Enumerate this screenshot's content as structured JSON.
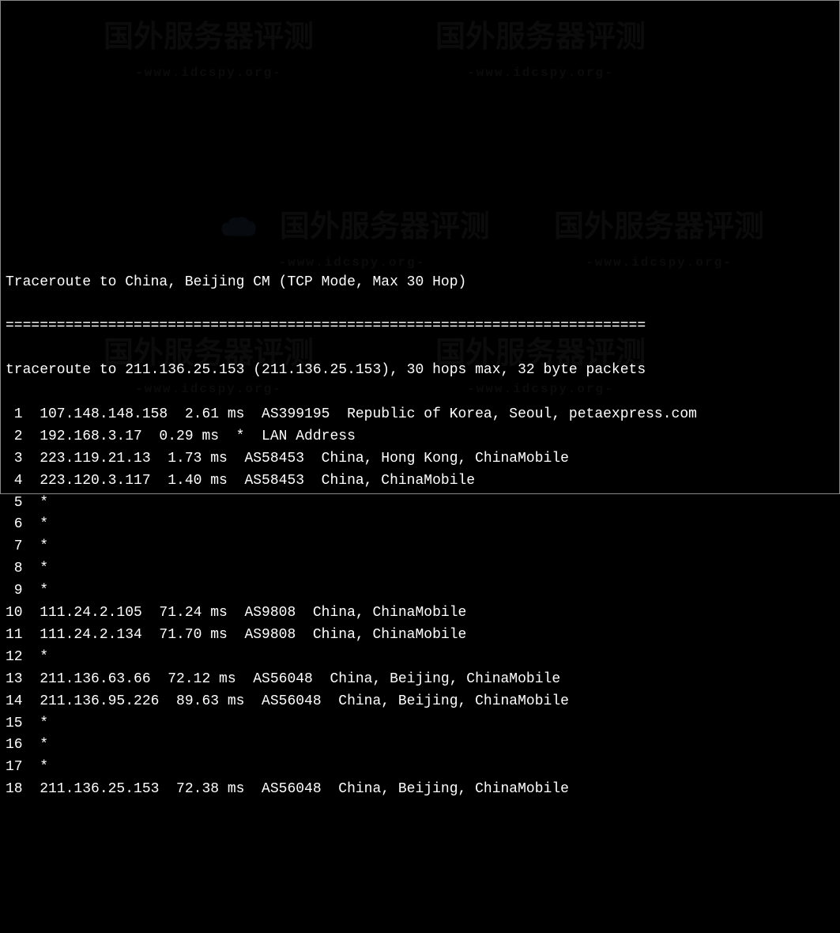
{
  "header": {
    "title": "Traceroute to China, Beijing CM (TCP Mode, Max 30 Hop)",
    "separator": "===========================================================================",
    "info": "traceroute to 211.136.25.153 (211.136.25.153), 30 hops max, 32 byte packets"
  },
  "hops": [
    {
      "num": " 1",
      "ip": "107.148.148.158",
      "rtt": "2.61 ms",
      "asn": "AS399195",
      "location": "Republic of Korea, Seoul, petaexpress.com"
    },
    {
      "num": " 2",
      "ip": "192.168.3.17",
      "rtt": "0.29 ms",
      "asn": "*",
      "location": "LAN Address"
    },
    {
      "num": " 3",
      "ip": "223.119.21.13",
      "rtt": "1.73 ms",
      "asn": "AS58453",
      "location": "China, Hong Kong, ChinaMobile"
    },
    {
      "num": " 4",
      "ip": "223.120.3.117",
      "rtt": "1.40 ms",
      "asn": "AS58453",
      "location": "China, ChinaMobile"
    },
    {
      "num": " 5",
      "ip": "*",
      "rtt": "",
      "asn": "",
      "location": ""
    },
    {
      "num": " 6",
      "ip": "*",
      "rtt": "",
      "asn": "",
      "location": ""
    },
    {
      "num": " 7",
      "ip": "*",
      "rtt": "",
      "asn": "",
      "location": ""
    },
    {
      "num": " 8",
      "ip": "*",
      "rtt": "",
      "asn": "",
      "location": ""
    },
    {
      "num": " 9",
      "ip": "*",
      "rtt": "",
      "asn": "",
      "location": ""
    },
    {
      "num": "10",
      "ip": "111.24.2.105",
      "rtt": "71.24 ms",
      "asn": "AS9808",
      "location": "China, ChinaMobile"
    },
    {
      "num": "11",
      "ip": "111.24.2.134",
      "rtt": "71.70 ms",
      "asn": "AS9808",
      "location": "China, ChinaMobile"
    },
    {
      "num": "12",
      "ip": "*",
      "rtt": "",
      "asn": "",
      "location": ""
    },
    {
      "num": "13",
      "ip": "211.136.63.66",
      "rtt": "72.12 ms",
      "asn": "AS56048",
      "location": "China, Beijing, ChinaMobile"
    },
    {
      "num": "14",
      "ip": "211.136.95.226",
      "rtt": "89.63 ms",
      "asn": "AS56048",
      "location": "China, Beijing, ChinaMobile"
    },
    {
      "num": "15",
      "ip": "*",
      "rtt": "",
      "asn": "",
      "location": ""
    },
    {
      "num": "16",
      "ip": "*",
      "rtt": "",
      "asn": "",
      "location": ""
    },
    {
      "num": "17",
      "ip": "*",
      "rtt": "",
      "asn": "",
      "location": ""
    },
    {
      "num": "18",
      "ip": "211.136.25.153",
      "rtt": "72.38 ms",
      "asn": "AS56048",
      "location": "China, Beijing, ChinaMobile"
    }
  ],
  "watermark": {
    "text": "国外服务器评测",
    "url": "-www.idcspy.org-"
  }
}
